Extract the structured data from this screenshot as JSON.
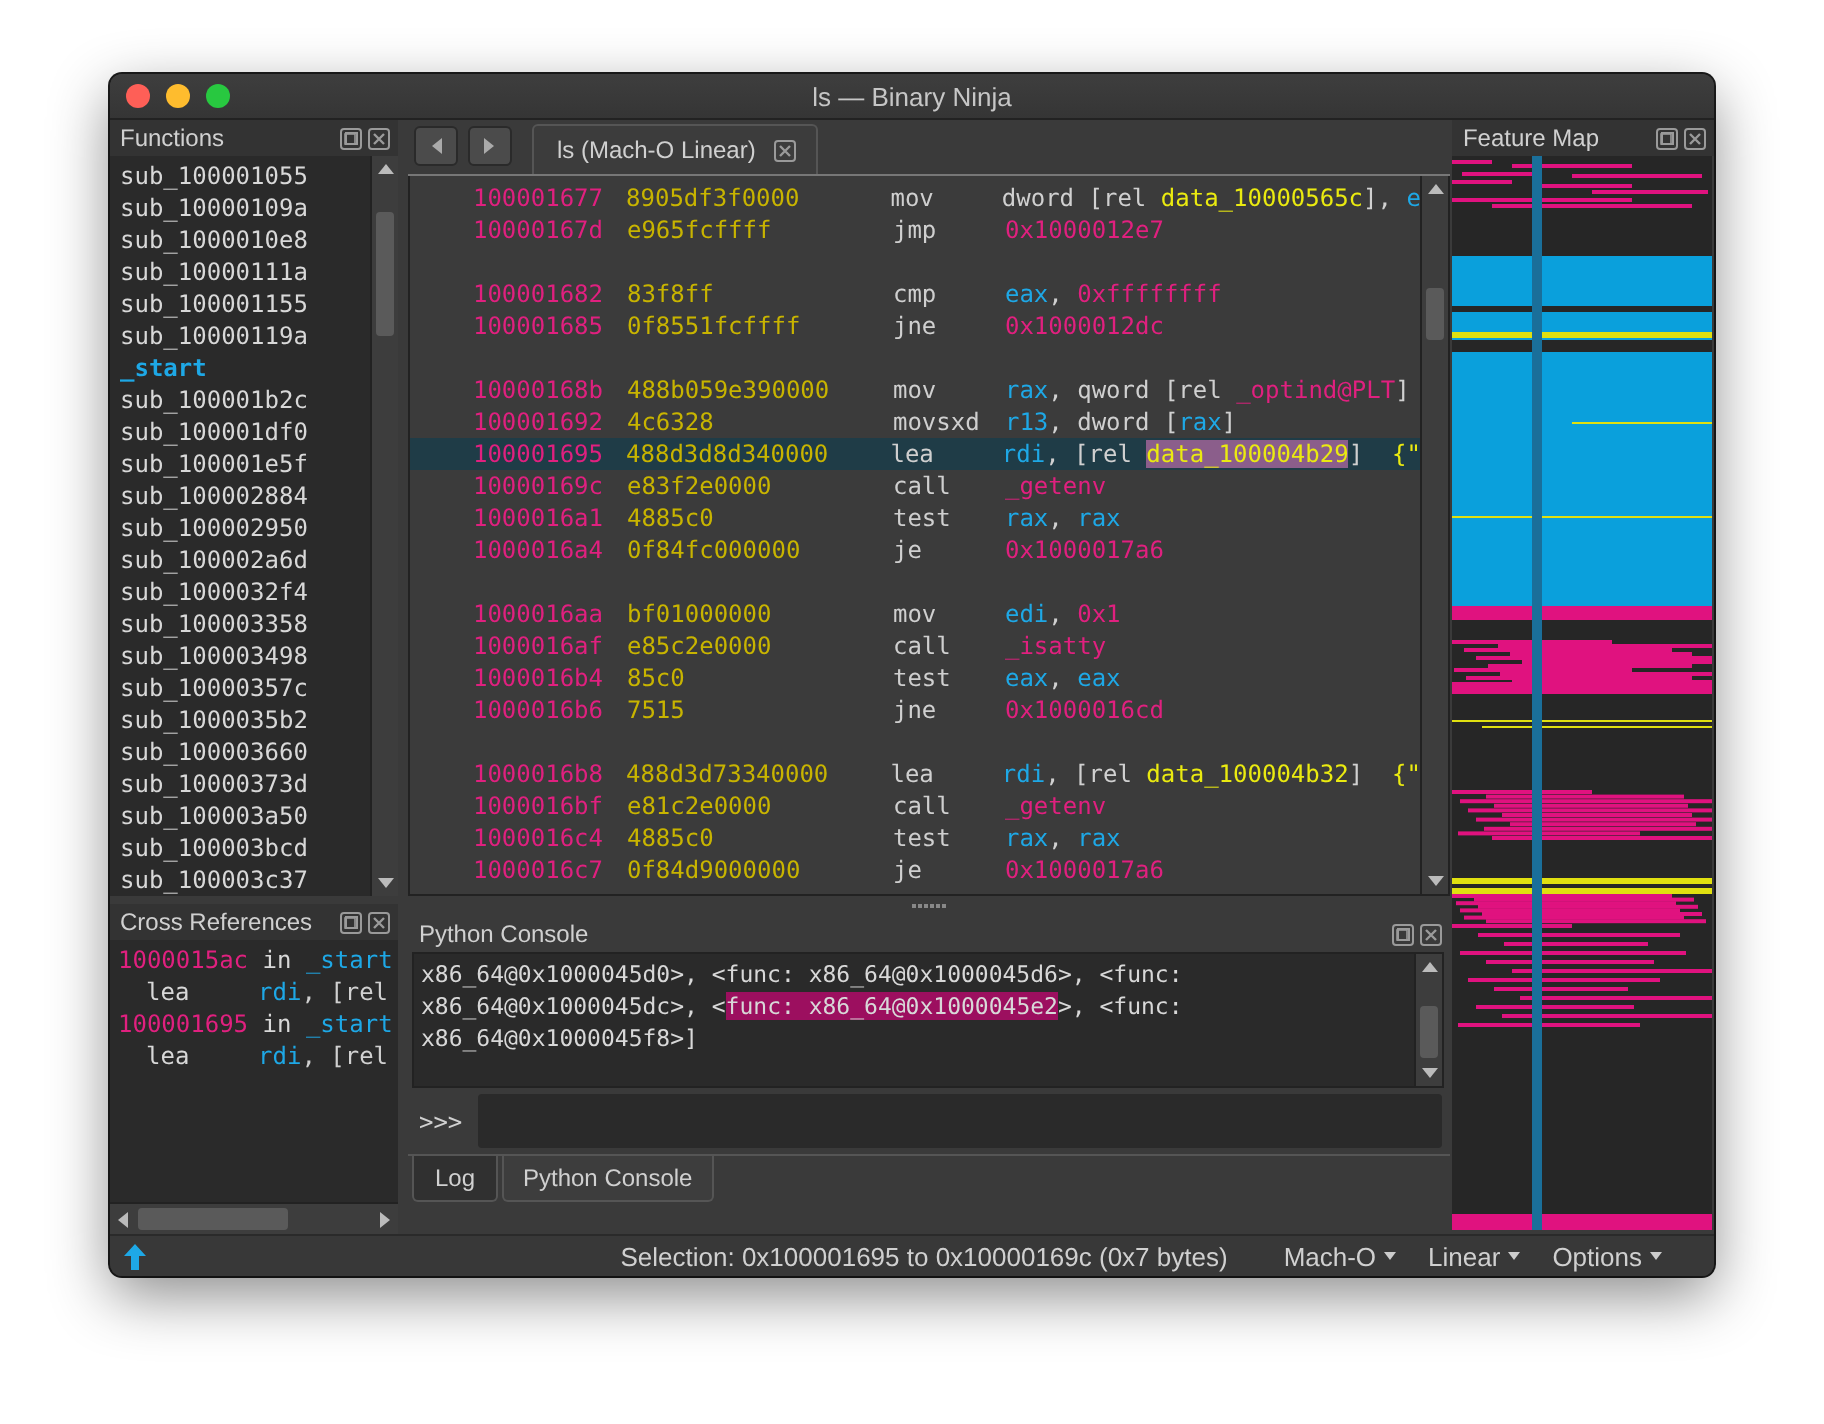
{
  "window": {
    "title": "ls — Binary Ninja"
  },
  "functions": {
    "title": "Functions",
    "items": [
      {
        "label": "sub_100001055",
        "selected": false
      },
      {
        "label": "sub_10000109a",
        "selected": false
      },
      {
        "label": "sub_1000010e8",
        "selected": false
      },
      {
        "label": "sub_10000111a",
        "selected": false
      },
      {
        "label": "sub_100001155",
        "selected": false
      },
      {
        "label": "sub_10000119a",
        "selected": false
      },
      {
        "label": "_start",
        "selected": true
      },
      {
        "label": "sub_100001b2c",
        "selected": false
      },
      {
        "label": "sub_100001df0",
        "selected": false
      },
      {
        "label": "sub_100001e5f",
        "selected": false
      },
      {
        "label": "sub_100002884",
        "selected": false
      },
      {
        "label": "sub_100002950",
        "selected": false
      },
      {
        "label": "sub_100002a6d",
        "selected": false
      },
      {
        "label": "sub_1000032f4",
        "selected": false
      },
      {
        "label": "sub_100003358",
        "selected": false
      },
      {
        "label": "sub_100003498",
        "selected": false
      },
      {
        "label": "sub_10000357c",
        "selected": false
      },
      {
        "label": "sub_1000035b2",
        "selected": false
      },
      {
        "label": "sub_100003660",
        "selected": false
      },
      {
        "label": "sub_10000373d",
        "selected": false
      },
      {
        "label": "sub_100003a50",
        "selected": false
      },
      {
        "label": "sub_100003bcd",
        "selected": false
      },
      {
        "label": "sub_100003c37",
        "selected": false
      }
    ]
  },
  "cross_references": {
    "title": "Cross References",
    "items": [
      {
        "address": "1000015ac",
        "preposition": "in",
        "function": "_start",
        "mnemonic": "lea",
        "operands": [
          {
            "kind": "register",
            "text": "rdi"
          },
          {
            "kind": "text",
            "text": ", [rel"
          }
        ]
      },
      {
        "address": "100001695",
        "preposition": "in",
        "function": "_start",
        "mnemonic": "lea",
        "operands": [
          {
            "kind": "register",
            "text": "rdi"
          },
          {
            "kind": "text",
            "text": ", [rel"
          }
        ]
      }
    ]
  },
  "editor": {
    "tab": {
      "label": "ls (Mach-O Linear)",
      "selected": true
    },
    "lines": [
      {
        "kind": "instr",
        "address": "100001677",
        "bytes": "8905df3f0000",
        "mnemonic": "mov",
        "selected": false,
        "operands": [
          {
            "kind": "text",
            "text": "dword [rel "
          },
          {
            "kind": "data",
            "text": "data_10000565c",
            "highlighted": false
          },
          {
            "kind": "text",
            "text": "], "
          },
          {
            "kind": "register",
            "text": "e"
          }
        ]
      },
      {
        "kind": "instr",
        "address": "10000167d",
        "bytes": "e965fcffff",
        "mnemonic": "jmp",
        "selected": false,
        "operands": [
          {
            "kind": "integer",
            "text": "0x1000012e7"
          }
        ]
      },
      {
        "kind": "blank"
      },
      {
        "kind": "instr",
        "address": "100001682",
        "bytes": "83f8ff",
        "mnemonic": "cmp",
        "selected": false,
        "operands": [
          {
            "kind": "register",
            "text": "eax"
          },
          {
            "kind": "text",
            "text": ", "
          },
          {
            "kind": "integer",
            "text": "0xffffffff"
          }
        ]
      },
      {
        "kind": "instr",
        "address": "100001685",
        "bytes": "0f8551fcffff",
        "mnemonic": "jne",
        "selected": false,
        "operands": [
          {
            "kind": "integer",
            "text": "0x1000012dc"
          }
        ]
      },
      {
        "kind": "blank"
      },
      {
        "kind": "instr",
        "address": "10000168b",
        "bytes": "488b059e390000",
        "mnemonic": "mov",
        "selected": false,
        "operands": [
          {
            "kind": "register",
            "text": "rax"
          },
          {
            "kind": "text",
            "text": ", qword [rel "
          },
          {
            "kind": "import",
            "text": "_optind@PLT"
          },
          {
            "kind": "text",
            "text": "]"
          }
        ]
      },
      {
        "kind": "instr",
        "address": "100001692",
        "bytes": "4c6328",
        "mnemonic": "movsxd",
        "selected": false,
        "operands": [
          {
            "kind": "register",
            "text": "r13"
          },
          {
            "kind": "text",
            "text": ", dword ["
          },
          {
            "kind": "register",
            "text": "rax"
          },
          {
            "kind": "text",
            "text": "]"
          }
        ]
      },
      {
        "kind": "instr",
        "address": "100001695",
        "bytes": "488d3d8d340000",
        "mnemonic": "lea",
        "selected": true,
        "operands": [
          {
            "kind": "register",
            "text": "rdi"
          },
          {
            "kind": "text",
            "text": ", [rel "
          },
          {
            "kind": "data",
            "text": "data_100004b29",
            "highlighted": true
          },
          {
            "kind": "text",
            "text": "]  "
          },
          {
            "kind": "string",
            "text": "{\""
          }
        ]
      },
      {
        "kind": "instr",
        "address": "10000169c",
        "bytes": "e83f2e0000",
        "mnemonic": "call",
        "selected": false,
        "operands": [
          {
            "kind": "import",
            "text": "_getenv"
          }
        ]
      },
      {
        "kind": "instr",
        "address": "1000016a1",
        "bytes": "4885c0",
        "mnemonic": "test",
        "selected": false,
        "operands": [
          {
            "kind": "register",
            "text": "rax"
          },
          {
            "kind": "text",
            "text": ", "
          },
          {
            "kind": "register",
            "text": "rax"
          }
        ]
      },
      {
        "kind": "instr",
        "address": "1000016a4",
        "bytes": "0f84fc000000",
        "mnemonic": "je",
        "selected": false,
        "operands": [
          {
            "kind": "integer",
            "text": "0x1000017a6"
          }
        ]
      },
      {
        "kind": "blank"
      },
      {
        "kind": "instr",
        "address": "1000016aa",
        "bytes": "bf01000000",
        "mnemonic": "mov",
        "selected": false,
        "operands": [
          {
            "kind": "register",
            "text": "edi"
          },
          {
            "kind": "text",
            "text": ", "
          },
          {
            "kind": "integer",
            "text": "0x1"
          }
        ]
      },
      {
        "kind": "instr",
        "address": "1000016af",
        "bytes": "e85c2e0000",
        "mnemonic": "call",
        "selected": false,
        "operands": [
          {
            "kind": "import",
            "text": "_isatty"
          }
        ]
      },
      {
        "kind": "instr",
        "address": "1000016b4",
        "bytes": "85c0",
        "mnemonic": "test",
        "selected": false,
        "operands": [
          {
            "kind": "register",
            "text": "eax"
          },
          {
            "kind": "text",
            "text": ", "
          },
          {
            "kind": "register",
            "text": "eax"
          }
        ]
      },
      {
        "kind": "instr",
        "address": "1000016b6",
        "bytes": "7515",
        "mnemonic": "jne",
        "selected": false,
        "operands": [
          {
            "kind": "integer",
            "text": "0x1000016cd"
          }
        ]
      },
      {
        "kind": "blank"
      },
      {
        "kind": "instr",
        "address": "1000016b8",
        "bytes": "488d3d73340000",
        "mnemonic": "lea",
        "selected": false,
        "operands": [
          {
            "kind": "register",
            "text": "rdi"
          },
          {
            "kind": "text",
            "text": ", [rel "
          },
          {
            "kind": "data",
            "text": "data_100004b32",
            "highlighted": false
          },
          {
            "kind": "text",
            "text": "]  "
          },
          {
            "kind": "string",
            "text": "{\""
          }
        ]
      },
      {
        "kind": "instr",
        "address": "1000016bf",
        "bytes": "e81c2e0000",
        "mnemonic": "call",
        "selected": false,
        "operands": [
          {
            "kind": "import",
            "text": "_getenv"
          }
        ]
      },
      {
        "kind": "instr",
        "address": "1000016c4",
        "bytes": "4885c0",
        "mnemonic": "test",
        "selected": false,
        "operands": [
          {
            "kind": "register",
            "text": "rax"
          },
          {
            "kind": "text",
            "text": ", "
          },
          {
            "kind": "register",
            "text": "rax"
          }
        ]
      },
      {
        "kind": "instr",
        "address": "1000016c7",
        "bytes": "0f84d9000000",
        "mnemonic": "je",
        "selected": false,
        "operands": [
          {
            "kind": "integer",
            "text": "0x1000017a6"
          }
        ]
      }
    ]
  },
  "python_console": {
    "title": "Python Console",
    "output": [
      [
        {
          "text": "x86_64@0x1000045d0>, <func: x86_64@0x1000045d6>, <func:",
          "highlighted": false
        }
      ],
      [
        {
          "text": "x86_64@0x1000045dc>, <",
          "highlighted": false
        },
        {
          "text": "func: x86_64@0x1000045e2",
          "highlighted": true
        },
        {
          "text": ">, <func:",
          "highlighted": false
        }
      ],
      [
        {
          "text": "x86_64@0x1000045f8>]",
          "highlighted": false
        }
      ]
    ],
    "prompt": ">>>",
    "tabs": [
      {
        "label": "Log",
        "selected": false
      },
      {
        "label": "Python Console",
        "selected": true
      }
    ]
  },
  "feature_map": {
    "title": "Feature Map"
  },
  "status_bar": {
    "selection": "Selection: 0x100001695 to 0x10000169c (0x7 bytes)",
    "menus": [
      {
        "label": "Mach-O"
      },
      {
        "label": "Linear"
      },
      {
        "label": "Options"
      }
    ]
  }
}
